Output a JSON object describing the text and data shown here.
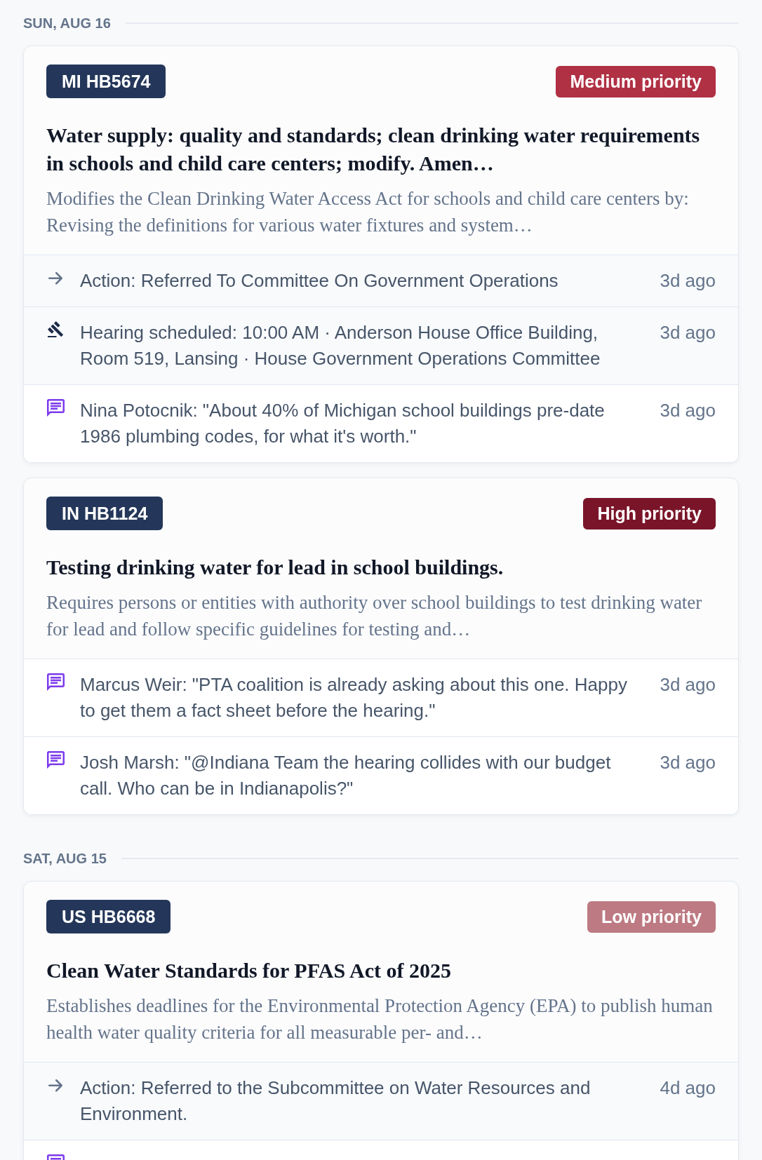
{
  "days": [
    {
      "date": "SUN, AUG 16",
      "bills": [
        {
          "bill_id": "MI HB5674",
          "priority": {
            "label": "Medium priority",
            "color": "#b03044"
          },
          "title": "Water supply: quality and standards; clean drinking water requirements in schools and child care centers; modify. Amen…",
          "summary": "Modifies the Clean Drinking Water Access Act for schools and child care centers by: Revising the definitions for various water fixtures and system…",
          "events": [
            {
              "kind": "action",
              "text": "Action: Referred To Committee On Government Operations",
              "time": "3d ago"
            },
            {
              "kind": "hearing",
              "text": "Hearing scheduled: 10:00 AM · Anderson House Office Building, Room 519, Lansing · House Government Operations Committee",
              "time": "3d ago"
            },
            {
              "kind": "comment",
              "text": "Nina Potocnik: \"About 40% of Michigan school buildings pre-date 1986 plumbing codes, for what it's worth.\"",
              "time": "3d ago"
            }
          ]
        },
        {
          "bill_id": "IN HB1124",
          "priority": {
            "label": "High priority",
            "color": "#7a1529"
          },
          "title": "Testing drinking water for lead in school buildings.",
          "summary": "Requires persons or entities with authority over school buildings to test drinking water for lead and follow specific guidelines for testing and…",
          "events": [
            {
              "kind": "comment",
              "text": "Marcus Weir: \"PTA coalition is already asking about this one. Happy to get them a fact sheet before the hearing.\"",
              "time": "3d ago"
            },
            {
              "kind": "comment",
              "text": "Josh Marsh: \"@Indiana Team the hearing collides with our budget call. Who can be in Indianapolis?\"",
              "time": "3d ago"
            }
          ]
        }
      ]
    },
    {
      "date": "SAT, AUG 15",
      "bills": [
        {
          "bill_id": "US HB6668",
          "priority": {
            "label": "Low priority",
            "color": "#bd7a82"
          },
          "title": "Clean Water Standards for PFAS Act of 2025",
          "summary": "Establishes deadlines for the Environmental Protection Agency (EPA) to publish human health water quality criteria for all measurable per- and…",
          "events": [
            {
              "kind": "action",
              "text": "Action: Referred to the Subcommittee on Water Resources and Environment.",
              "time": "4d ago"
            },
            {
              "kind": "comment"
            }
          ]
        }
      ]
    }
  ]
}
